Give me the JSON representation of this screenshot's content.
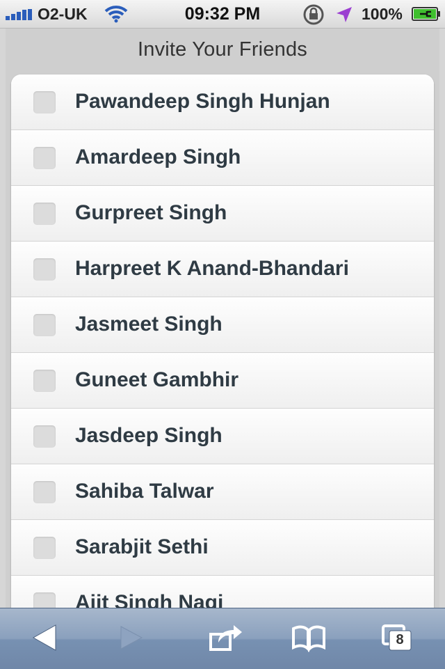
{
  "status_bar": {
    "carrier": "O2-UK",
    "time": "09:32 PM",
    "battery": "100%"
  },
  "page": {
    "title": "Invite Your Friends"
  },
  "friends": [
    "Pawandeep Singh Hunjan",
    "Amardeep Singh",
    "Gurpreet Singh",
    "Harpreet K Anand-Bhandari",
    "Jasmeet Singh",
    "Guneet Gambhir",
    "Jasdeep Singh",
    "Sahiba Talwar",
    "Sarabjit Sethi",
    "Ajit Singh Nagi"
  ],
  "toolbar": {
    "tab_count": "8",
    "icons": [
      "back-icon",
      "forward-icon",
      "share-icon",
      "bookmarks-icon",
      "tabs-icon"
    ]
  }
}
